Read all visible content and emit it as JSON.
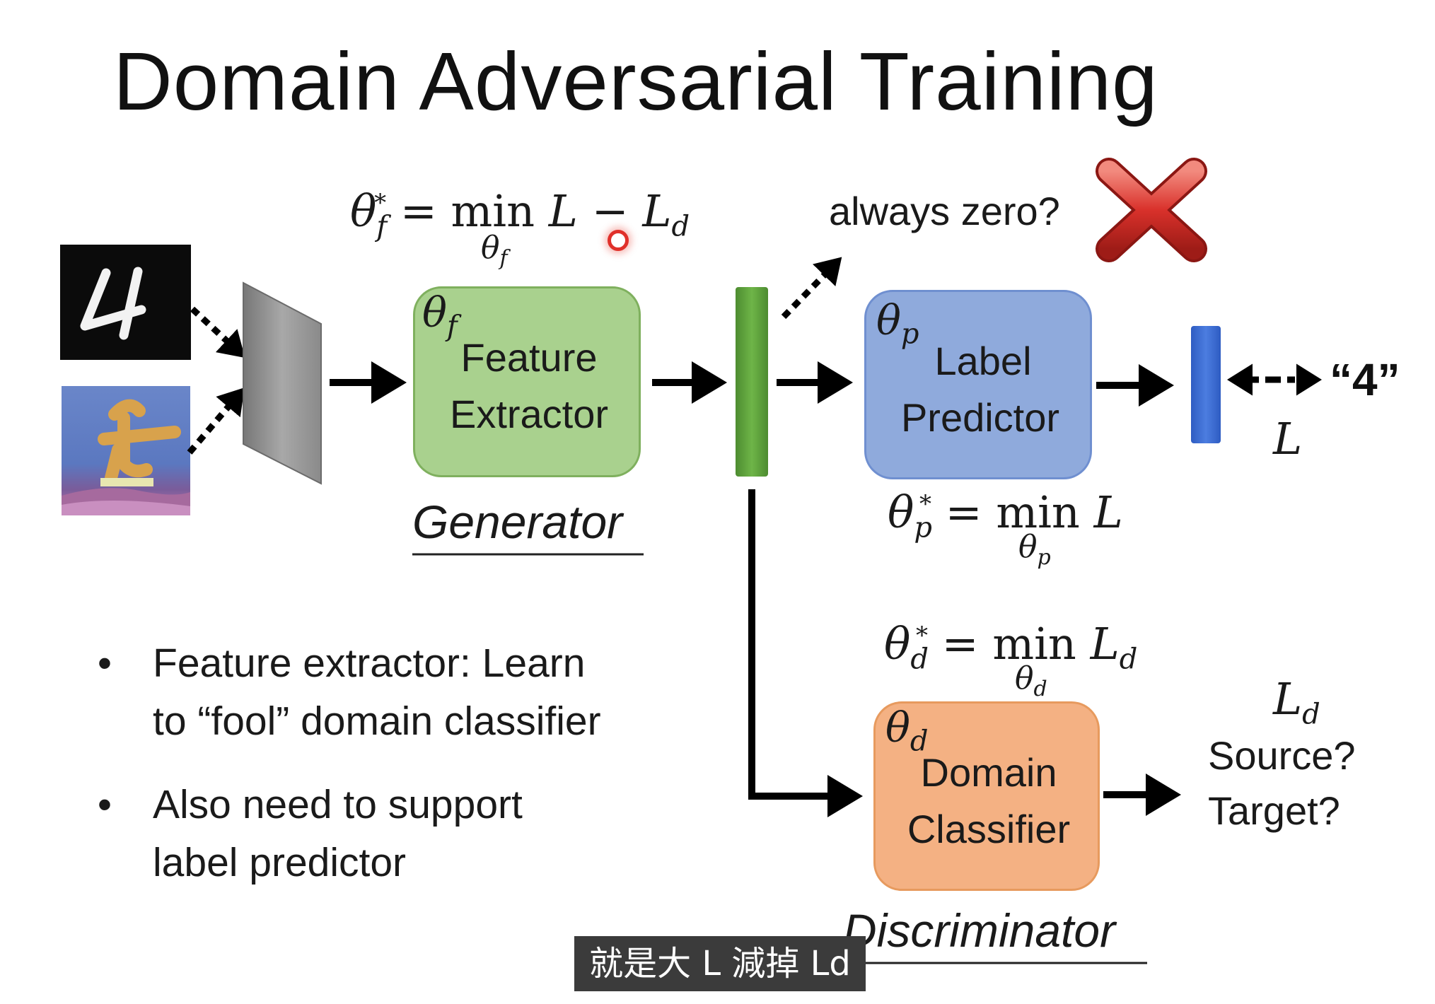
{
  "title": "Domain Adversarial Training",
  "equations": {
    "feature": {
      "lhs": "θ",
      "lhs_sub": "f",
      "lhs_sup": "*",
      "op": "= min",
      "under": "θ",
      "under_sub": "f",
      "rhs1": "L",
      "minus": "−",
      "rhs2": "L",
      "rhs2_sub": "d"
    },
    "label": {
      "lhs": "θ",
      "lhs_sub": "p",
      "lhs_sup": "*",
      "op": "= min",
      "under": "θ",
      "under_sub": "p",
      "rhs": "L"
    },
    "domain": {
      "lhs": "θ",
      "lhs_sub": "d",
      "lhs_sup": "*",
      "op": "= min",
      "under": "θ",
      "under_sub": "d",
      "rhs": "L",
      "rhs_sub": "d"
    }
  },
  "always_zero": "always zero?",
  "boxes": {
    "feature_extractor": {
      "param": "θ",
      "param_sub": "f",
      "line1": "Feature",
      "line2": "Extractor",
      "color": "#a9d18e",
      "border": "#7fb05e"
    },
    "label_predictor": {
      "param": "θ",
      "param_sub": "p",
      "line1": "Label",
      "line2": "Predictor",
      "color": "#8faadc",
      "border": "#6f8fd0"
    },
    "domain_classifier": {
      "param": "θ",
      "param_sub": "d",
      "line1": "Domain",
      "line2": "Classifier",
      "color": "#f4b183",
      "border": "#e79a5e"
    }
  },
  "roles": {
    "generator": "Generator",
    "discriminator": "Discriminator"
  },
  "output": {
    "label": "“4”",
    "loss": "L"
  },
  "domain_output": {
    "loss": "L",
    "loss_sub": "d",
    "q1": "Source?",
    "q2": "Target?"
  },
  "bullets": [
    {
      "line1": "Feature extractor: Learn",
      "line2": "to “fool” domain classifier"
    },
    {
      "line1": "Also need to support",
      "line2": "label predictor"
    }
  ],
  "subtitle": "就是大 L 減掉 Ld",
  "colors": {
    "feature_bar": "#5a9e3a",
    "output_bar": "#3a6ad0",
    "cross": "#d9312b"
  }
}
